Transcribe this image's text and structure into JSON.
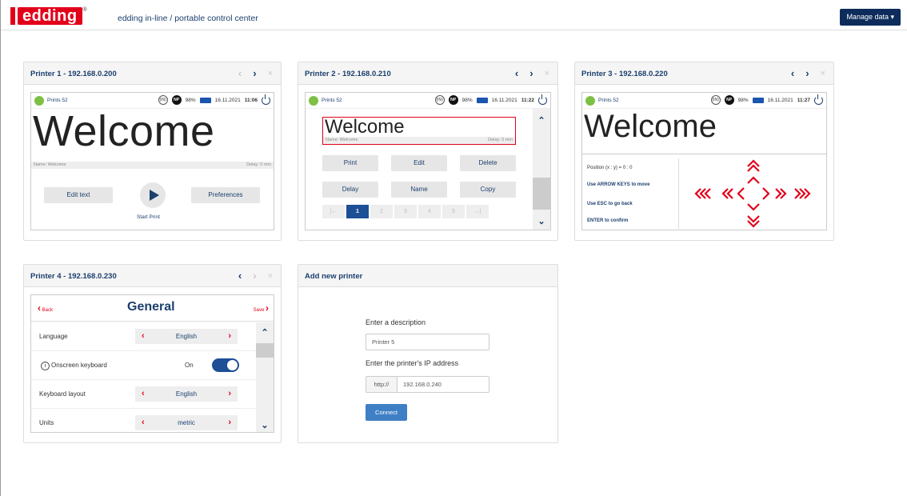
{
  "header": {
    "app_title": "edding in-line / portable control center",
    "logo_text": "edding",
    "manage_label": "Manage data ▾"
  },
  "printer1": {
    "title": "Printer 1 - 192.168.0.200",
    "prints": "Prints 52",
    "cartridge": "(IN)",
    "np": "NP",
    "battery_pct": "98%",
    "date": "16.11.2021",
    "time": "11:06",
    "welcome": "Welcome",
    "name_tag": "Name: Welcome",
    "delay_tag": "Delay: 0 mm",
    "edit_text": "Edit text",
    "start_print": "Start Print",
    "preferences": "Preferences"
  },
  "printer2": {
    "title": "Printer 2 - 192.168.0.210",
    "prints": "Prints 52",
    "cartridge": "(IN)",
    "np": "NP",
    "battery_pct": "98%",
    "date": "16.11.2021",
    "time": "11:22",
    "welcome": "Welcome",
    "name_tag": "Name: Welcome",
    "delay_tag": "Delay: 0 mm",
    "buttons": [
      "Print",
      "Edit",
      "Delete",
      "Delay",
      "Name",
      "Copy"
    ],
    "pages": [
      "|←",
      "1",
      "2",
      "3",
      "4",
      "5",
      "→|"
    ]
  },
  "printer3": {
    "title": "Printer 3 - 192.168.0.220",
    "prints": "Prints 52",
    "cartridge": "(IN)",
    "np": "NP",
    "battery_pct": "98%",
    "date": "16.11.2021",
    "time": "11:27",
    "welcome": "Welcome",
    "position": "Position (x : y) = 0 : 0",
    "hint_move": "Use ARROW KEYS to move",
    "hint_back": "Use ESC to go back",
    "hint_confirm": "ENTER to confirm"
  },
  "printer4": {
    "title": "Printer 4 - 192.168.0.230",
    "back": "Back",
    "heading": "General",
    "save": "Save",
    "rows": [
      {
        "label": "Language",
        "value": "English"
      },
      {
        "label": "Onscreen keyboard",
        "value": "On"
      },
      {
        "label": "Keyboard layout",
        "value": "English"
      },
      {
        "label": "Units",
        "value": "metric"
      }
    ]
  },
  "add_printer": {
    "title": "Add new printer",
    "desc_label": "Enter a description",
    "desc_value": "Printer 5",
    "ip_label": "Enter the printer's IP address",
    "ip_prefix": "http://",
    "ip_value": "192.168.0.240",
    "connect": "Connect"
  },
  "colors": {
    "brand_red": "#e2001a",
    "navy": "#0d2c5c",
    "accent_blue": "#1c4f96"
  }
}
